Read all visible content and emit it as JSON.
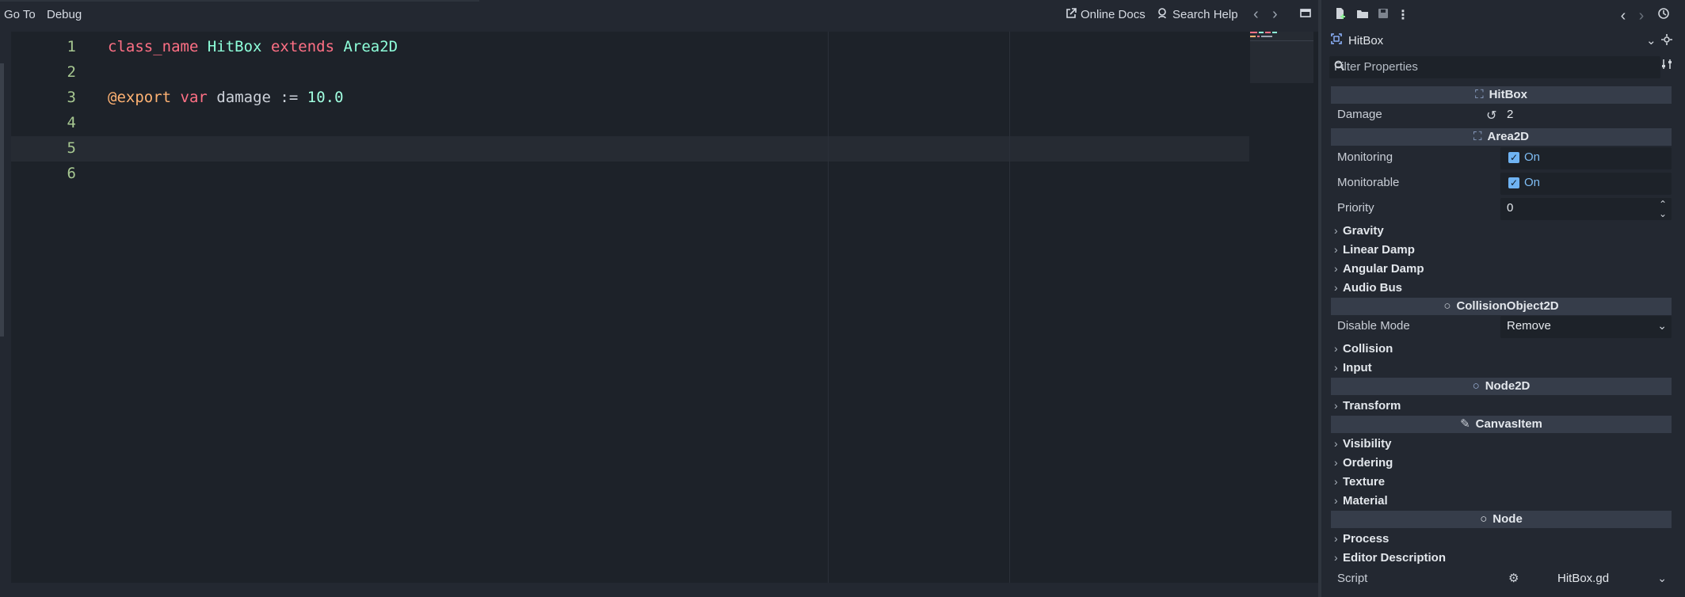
{
  "editor": {
    "menu": {
      "goto": "Go To",
      "debug": "Debug"
    },
    "actions": {
      "online_docs": "Online Docs",
      "search_help": "Search Help"
    },
    "lines": [
      {
        "num": "1"
      },
      {
        "num": "2"
      },
      {
        "num": "3"
      },
      {
        "num": "4"
      },
      {
        "num": "5"
      },
      {
        "num": "6"
      }
    ],
    "code": {
      "l1": {
        "kw1": "class_name",
        "name": "HitBox",
        "kw2": "extends",
        "base": "Area2D"
      },
      "l3": {
        "anno": "@export",
        "kw": "var",
        "ident": "damage",
        "op": ":=",
        "value": "10.0"
      }
    }
  },
  "inspector": {
    "node_name": "HitBox",
    "filter_placeholder": "Filter Properties",
    "sections": {
      "hitbox": "HitBox",
      "area2d": "Area2D",
      "collision_object": "CollisionObject2D",
      "node2d": "Node2D",
      "canvas_item": "CanvasItem",
      "node": "Node"
    },
    "props": {
      "damage": {
        "label": "Damage",
        "value": "2"
      },
      "monitoring": {
        "label": "Monitoring",
        "value": "On"
      },
      "monitorable": {
        "label": "Monitorable",
        "value": "On"
      },
      "priority": {
        "label": "Priority",
        "value": "0"
      },
      "disable_mode": {
        "label": "Disable Mode",
        "value": "Remove"
      },
      "script": {
        "label": "Script",
        "value": "HitBox.gd"
      }
    },
    "groups": {
      "gravity": "Gravity",
      "linear_damp": "Linear Damp",
      "angular_damp": "Angular Damp",
      "audio_bus": "Audio Bus",
      "collision": "Collision",
      "input": "Input",
      "transform": "Transform",
      "visibility": "Visibility",
      "ordering": "Ordering",
      "texture": "Texture",
      "material": "Material",
      "process": "Process",
      "editor_description": "Editor Description"
    }
  },
  "colors": {
    "keyword": "#ff7085",
    "class": "#8effda",
    "annotation": "#ffb373",
    "number": "#a1ffe0",
    "line_number": "#a7c891",
    "accent": "#6fb3f2"
  }
}
